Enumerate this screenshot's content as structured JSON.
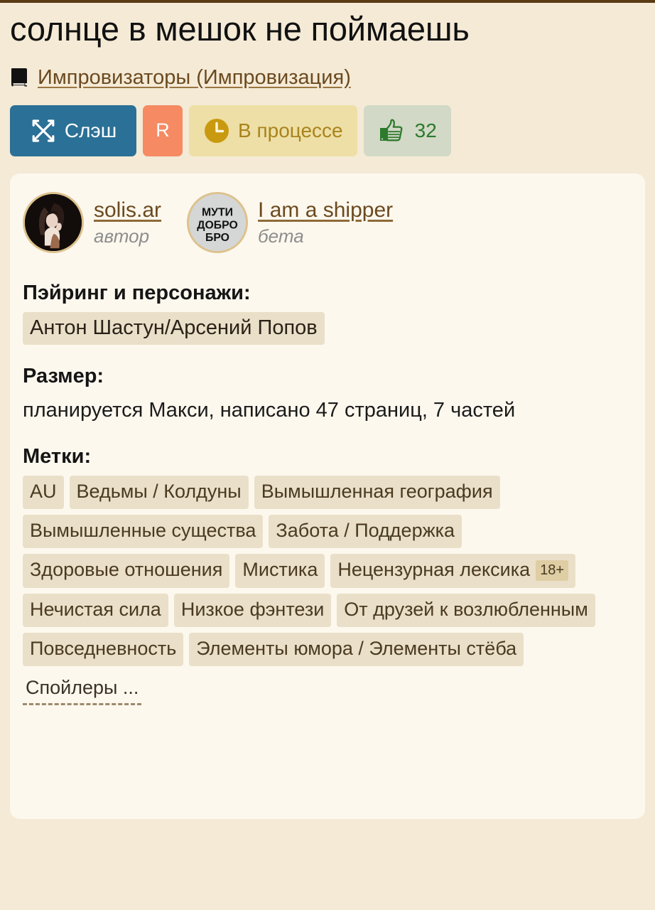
{
  "page": {
    "background_color": "#f4ead6",
    "card_background_color": "#fdf8ee",
    "top_rule_color": "#5a3b16"
  },
  "header": {
    "title": "солнце в мешок не поймаешь",
    "fandom": {
      "icon": "book-icon",
      "label": "Импровизаторы (Импровизация)"
    }
  },
  "badges": {
    "direction": {
      "icon": "crossed-arrows-icon",
      "label": "Слэш",
      "color": "#2b7096"
    },
    "rating": {
      "label": "R",
      "color": "#f58a63"
    },
    "status": {
      "icon": "clock-icon",
      "label": "В процессе",
      "color": "#eedfa6",
      "text_color": "#a8841c"
    },
    "likes": {
      "icon": "thumbs-up-icon",
      "count": "32",
      "color": "#d2d9c6",
      "text_color": "#2d7a2d"
    }
  },
  "people": [
    {
      "avatar": "author-avatar",
      "name": "solis.ar",
      "role": "автор"
    },
    {
      "avatar": "beta-avatar",
      "avatar_text_lines": [
        "МУТИ",
        "ДОБРО",
        "БРО"
      ],
      "name": "I am a shipper",
      "role": "бета"
    }
  ],
  "fields": {
    "pairing": {
      "label": "Пэйринг и персонажи:",
      "values": [
        "Антон Шастун/Арсений Попов"
      ]
    },
    "size": {
      "label": "Размер:",
      "value": "планируется Макси, написано 47 страниц, 7 частей"
    },
    "tags": {
      "label": "Метки:",
      "items": [
        {
          "label": "AU"
        },
        {
          "label": "Ведьмы / Колдуны"
        },
        {
          "label": "Вымышленная география"
        },
        {
          "label": "Вымышленные существа"
        },
        {
          "label": "Забота / Поддержка"
        },
        {
          "label": "Здоровые отношения"
        },
        {
          "label": "Мистика"
        },
        {
          "label": "Нецензурная лексика",
          "adult": "18+"
        },
        {
          "label": "Нечистая сила"
        },
        {
          "label": "Низкое фэнтези"
        },
        {
          "label": "От друзей к возлюбленным"
        },
        {
          "label": "Повседневность"
        },
        {
          "label": "Элементы юмора / Элементы стёба"
        }
      ],
      "spoilers_label": "Спойлеры ..."
    }
  }
}
